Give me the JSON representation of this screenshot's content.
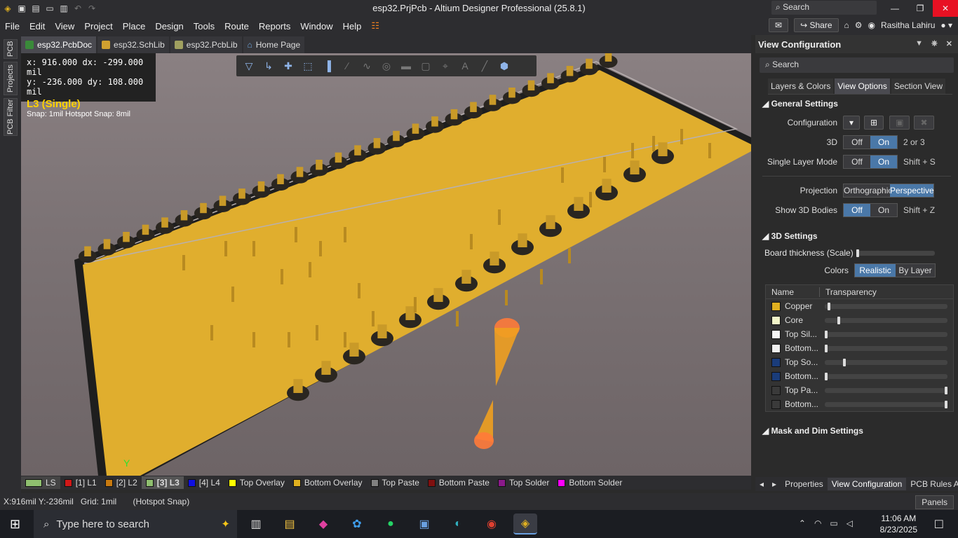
{
  "window": {
    "title": "esp32.PrjPcb - Altium Designer Professional (25.8.1)",
    "search_placeholder": "Search"
  },
  "menu": {
    "items": [
      "File",
      "Edit",
      "View",
      "Project",
      "Place",
      "Design",
      "Tools",
      "Route",
      "Reports",
      "Window",
      "Help"
    ],
    "share_label": "Share",
    "user_name": "Rasitha Lahiru"
  },
  "side_tabs": [
    "PCB",
    "Projects",
    "PCB Filter"
  ],
  "doc_tabs": [
    {
      "label": "esp32.PcbDoc",
      "active": true
    },
    {
      "label": "esp32.SchLib",
      "active": false
    },
    {
      "label": "esp32.PcbLib",
      "active": false
    },
    {
      "label": "Home Page",
      "active": false
    }
  ],
  "coords_overlay": {
    "x_line": "x:  916.000   dx:  -299.000  mil",
    "y_line": "y: -236.000   dy:   108.000  mil",
    "layer": "L3 (Single)",
    "snap": "Snap: 1mil Hotspot Snap: 8mil"
  },
  "layer_tabs": [
    {
      "label": "LS",
      "color": "#8fbf6f",
      "kind": "ls"
    },
    {
      "label": "[1] L1",
      "color": "#d01818"
    },
    {
      "label": "[2] L2",
      "color": "#c87a10"
    },
    {
      "label": "[3] L3",
      "color": "#8fbf6f",
      "active": true
    },
    {
      "label": "[4] L4",
      "color": "#1010e0"
    },
    {
      "label": "Top Overlay",
      "color": "#ffff00"
    },
    {
      "label": "Bottom Overlay",
      "color": "#e0b020"
    },
    {
      "label": "Top Paste",
      "color": "#808080"
    },
    {
      "label": "Bottom Paste",
      "color": "#801010"
    },
    {
      "label": "Top Solder",
      "color": "#8a1a8a"
    },
    {
      "label": "Bottom Solder",
      "color": "#ff00ff"
    }
  ],
  "status": {
    "text": "X:916mil Y:-236mil   Grid: 1mil       (Hotspot Snap)",
    "panels_label": "Panels"
  },
  "panel": {
    "title": "View Configuration",
    "search_placeholder": "Search",
    "tabs": [
      "Layers & Colors",
      "View Options",
      "Section View"
    ],
    "active_tab": "View Options",
    "general_title": "General Settings",
    "configuration_label": "Configuration",
    "threeD_label": "3D",
    "threeD_shortcut": "2 or 3",
    "single_layer_label": "Single Layer Mode",
    "single_layer_shortcut": "Shift + S",
    "projection_label": "Projection",
    "projection_opts": [
      "Orthographic",
      "Perspective"
    ],
    "show3d_label": "Show 3D Bodies",
    "show3d_shortcut": "Shift + Z",
    "off_label": "Off",
    "on_label": "On",
    "threeD_settings_title": "3D Settings",
    "board_thickness_label": "Board thickness (Scale)",
    "colors_label": "Colors",
    "colors_opts": [
      "Realistic",
      "By Layer"
    ],
    "table_headers": [
      "Name",
      "Transparency"
    ],
    "table_rows": [
      {
        "name": "Copper",
        "color": "#e0b020",
        "level": 0.02
      },
      {
        "name": "Core",
        "color": "#f2f4c8",
        "level": 0.1
      },
      {
        "name": "Top Sil...",
        "color": "#f5f5f5",
        "level": 0.0
      },
      {
        "name": "Bottom...",
        "color": "#f0f0f0",
        "level": 0.0
      },
      {
        "name": "Top So...",
        "color": "#1a3c7a",
        "level": 0.15
      },
      {
        "name": "Bottom...",
        "color": "#1a3c7a",
        "level": 0.0
      },
      {
        "name": "Top Pa...",
        "color": "#3a3a3a",
        "level": 1.0
      },
      {
        "name": "Bottom...",
        "color": "#3a3a3a",
        "level": 1.0
      }
    ],
    "mask_title": "Mask and Dim Settings"
  },
  "panel_footer": [
    "Properties",
    "View Configuration",
    "PCB Rules An"
  ],
  "taskbar": {
    "search_placeholder": "Type here to search",
    "time": "11:06 AM",
    "date": "8/23/2025"
  }
}
